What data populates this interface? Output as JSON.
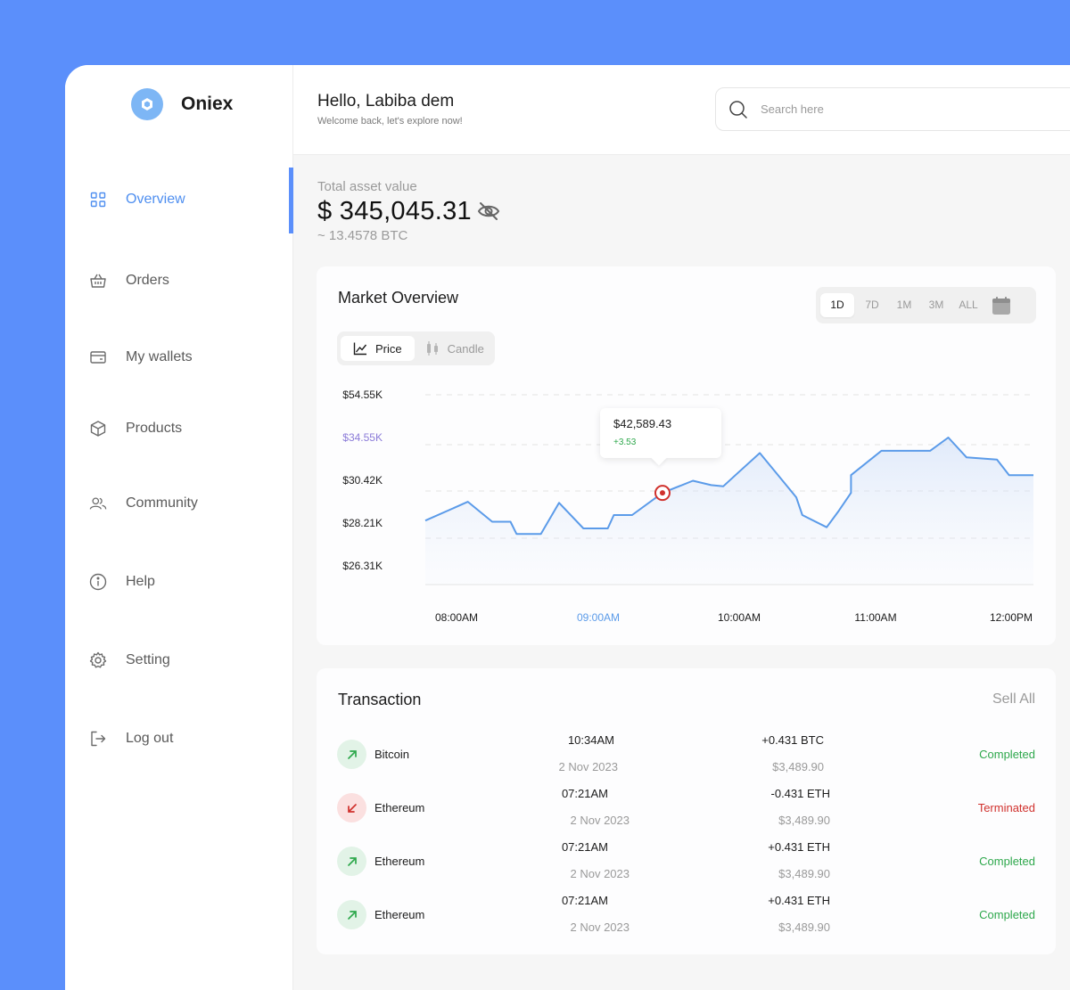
{
  "app": {
    "name": "Oniex"
  },
  "header": {
    "greeting": "Hello, Labiba dem",
    "subtitle": "Welcome back, let's explore now!",
    "search_placeholder": "Search here"
  },
  "sidebar": {
    "items": [
      {
        "label": "Overview",
        "icon": "grid-icon",
        "active": true
      },
      {
        "label": "Orders",
        "icon": "basket-icon"
      },
      {
        "label": "My wallets",
        "icon": "wallet-icon"
      },
      {
        "label": "Products",
        "icon": "box-icon"
      },
      {
        "label": "Community",
        "icon": "users-icon"
      },
      {
        "label": "Help",
        "icon": "info-icon"
      },
      {
        "label": "Setting",
        "icon": "gear-icon"
      },
      {
        "label": "Log out",
        "icon": "logout-icon"
      }
    ]
  },
  "asset": {
    "label": "Total asset value",
    "value": "$ 345,045.31",
    "btc": "~ 13.4578 BTC"
  },
  "market": {
    "title": "Market Overview",
    "ranges": [
      "1D",
      "7D",
      "1M",
      "3M",
      "ALL"
    ],
    "active_range": "1D",
    "modes": [
      "Price",
      "Candle"
    ],
    "active_mode": "Price",
    "tooltip": {
      "value": "$42,589.43",
      "change": "+3.53"
    }
  },
  "chart_data": {
    "type": "area",
    "y_ticks": [
      "$54.55K",
      "$34.55K",
      "$30.42K",
      "$28.21K",
      "$26.31K"
    ],
    "highlighted_y_tick": "$34.55K",
    "x_ticks": [
      "08:00AM",
      "09:00AM",
      "10:00AM",
      "11:00AM",
      "12:00PM"
    ],
    "highlighted_x_tick": "09:00AM",
    "series": [
      {
        "values": [
          [
            0.0,
            28.35
          ],
          [
            0.07,
            29.2
          ],
          [
            0.11,
            28.3
          ],
          [
            0.14,
            28.3
          ],
          [
            0.15,
            27.75
          ],
          [
            0.19,
            27.75
          ],
          [
            0.22,
            29.15
          ],
          [
            0.26,
            28.0
          ],
          [
            0.3,
            28.0
          ],
          [
            0.31,
            28.6
          ],
          [
            0.34,
            28.6
          ],
          [
            0.39,
            29.6
          ],
          [
            0.44,
            30.15
          ],
          [
            0.47,
            29.95
          ],
          [
            0.49,
            29.9
          ],
          [
            0.51,
            30.4
          ],
          [
            0.55,
            31.4
          ],
          [
            0.58,
            30.4
          ],
          [
            0.61,
            29.4
          ],
          [
            0.62,
            28.6
          ],
          [
            0.66,
            28.05
          ],
          [
            0.68,
            28.8
          ],
          [
            0.7,
            29.6
          ],
          [
            0.7,
            30.4
          ],
          [
            0.75,
            31.5
          ],
          [
            0.83,
            31.5
          ],
          [
            0.86,
            32.1
          ],
          [
            0.89,
            31.2
          ],
          [
            0.94,
            31.1
          ],
          [
            0.96,
            30.4
          ],
          [
            1.0,
            30.4
          ]
        ]
      }
    ],
    "highlight_point": {
      "x": 0.39,
      "value": "$42,589.43"
    },
    "line_color": "#5b9be9",
    "grid": "dashed-horizontal"
  },
  "transactions": {
    "title": "Transaction",
    "sell_all": "Sell All",
    "rows": [
      {
        "coin": "Bitcoin",
        "direction": "up",
        "time": "10:34AM",
        "date": "2 Nov 2023",
        "amount": "+0.431 BTC",
        "usd": "$3,489.90",
        "status": "Completed",
        "status_color": "#2ea84c"
      },
      {
        "coin": "Ethereum",
        "direction": "down",
        "time": "07:21AM",
        "date": "2 Nov 2023",
        "amount": "-0.431 ETH",
        "usd": "$3,489.90",
        "status": "Terminated",
        "status_color": "#d0312d"
      },
      {
        "coin": "Ethereum",
        "direction": "up",
        "time": "07:21AM",
        "date": "2 Nov 2023",
        "amount": "+0.431 ETH",
        "usd": "$3,489.90",
        "status": "Completed",
        "status_color": "#2ea84c"
      },
      {
        "coin": "Ethereum",
        "direction": "up",
        "time": "07:21AM",
        "date": "2 Nov 2023",
        "amount": "+0.431 ETH",
        "usd": "$3,489.90",
        "status": "Completed",
        "status_color": "#2ea84c"
      }
    ]
  },
  "colors": {
    "accent": "#5b8ffb",
    "up": "#2ea84c",
    "down": "#d0312d"
  }
}
